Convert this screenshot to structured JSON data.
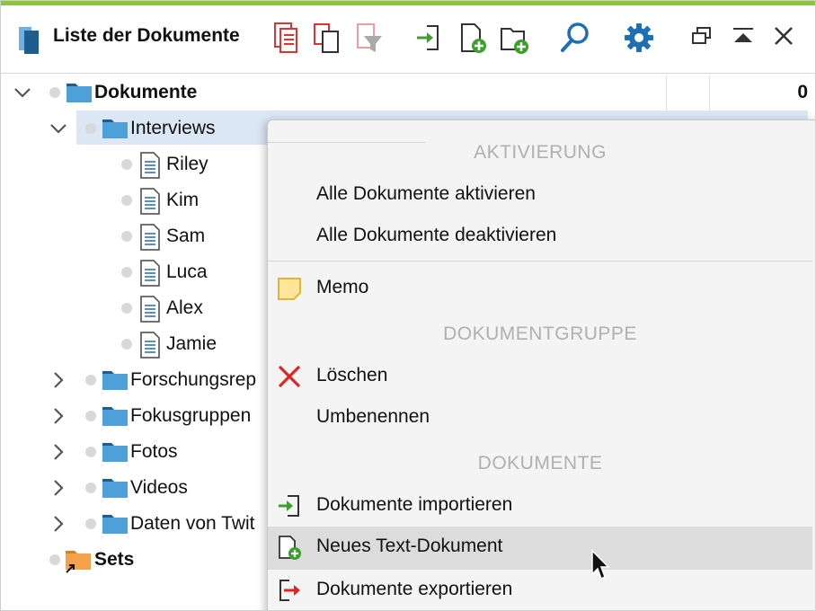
{
  "toolbar": {
    "title": "Liste der Dokumente",
    "icons": [
      "documents-app-icon",
      "document-list-icon",
      "copy-icon",
      "filter-icon",
      "import-icon",
      "new-document-icon",
      "new-folder-icon",
      "search-icon",
      "settings-icon",
      "undock-icon",
      "collapse-icon",
      "close-icon"
    ]
  },
  "tree": {
    "root": {
      "label": "Dokumente",
      "count": "0"
    },
    "interviews": {
      "label": "Interviews"
    },
    "docs": [
      "Riley",
      "Kim",
      "Sam",
      "Luca",
      "Alex",
      "Jamie"
    ],
    "groups": [
      "Forschungsrep",
      "Fokusgruppen",
      "Fotos",
      "Videos",
      "Daten von Twit"
    ],
    "sets": {
      "label": "Sets"
    }
  },
  "menu": {
    "section_activation": "AKTIVIERUNG",
    "activate_all": "Alle Dokumente aktivieren",
    "deactivate_all": "Alle Dokumente deaktivieren",
    "memo": "Memo",
    "section_group": "DOKUMENTGRUPPE",
    "delete": "Löschen",
    "rename": "Umbenennen",
    "section_documents": "DOKUMENTE",
    "import": "Dokumente importieren",
    "new_text": "Neues Text-Dokument",
    "export": "Dokumente exportieren"
  },
  "colors": {
    "accent_green": "#8cc63f",
    "folder_blue": "#4ea0d8",
    "folder_orange": "#f5a04a",
    "highlight": "#dcdcdc",
    "selection": "#dbe7f4"
  }
}
